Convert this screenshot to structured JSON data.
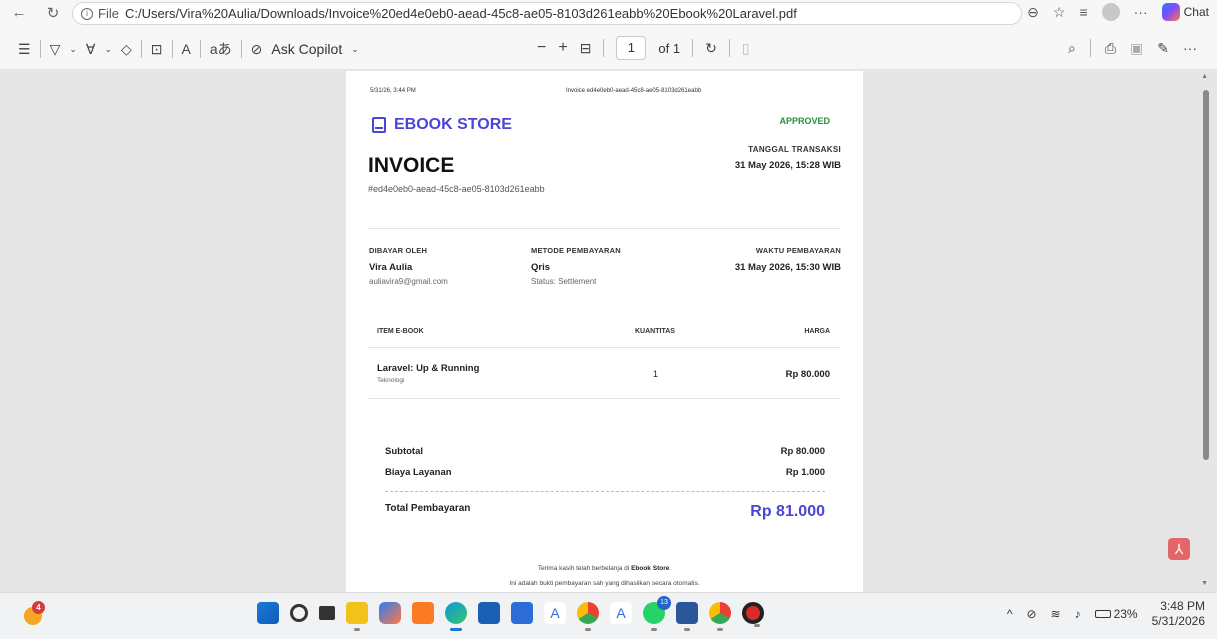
{
  "browser": {
    "url_prefix": "File",
    "url": "C:/Users/Vira%20Aulia/Downloads/Invoice%20ed4e0eb0-aead-45c8-ae05-8103d261eabb%20Ebook%20Laravel.pdf",
    "chat_label": "Chat"
  },
  "pdf_toolbar": {
    "ask_copilot": "Ask Copilot",
    "page_current": "1",
    "page_total": "of 1"
  },
  "invoice": {
    "header_datetime": "5/31/26, 3:44 PM",
    "header_title": "Invoice ed4e0eb0-aead-45c8-ae05-8103d261eabb",
    "brand": "EBOOK STORE",
    "status": "APPROVED",
    "title": "INVOICE",
    "transaction_label": "TANGGAL TRANSAKSI",
    "transaction_date": "31 May 2026, 15:28 WIB",
    "invoice_id": "#ed4e0eb0-aead-45c8-ae05-8103d261eabb",
    "paid_by_label": "DIBAYAR OLEH",
    "paid_by_name": "Vira Aulia",
    "paid_by_email": "auliavira9@gmail.com",
    "method_label": "METODE PEMBAYARAN",
    "method_value": "Qris",
    "method_status": "Status: Settlement",
    "payment_time_label": "WAKTU PEMBAYARAN",
    "payment_time_value": "31 May 2026, 15:30 WIB",
    "table_headers": {
      "item": "ITEM E-BOOK",
      "qty": "KUANTITAS",
      "price": "HARGA"
    },
    "items": [
      {
        "name": "Laravel: Up & Running",
        "category": "Teknologi",
        "qty": "1",
        "price": "Rp 80.000"
      }
    ],
    "subtotal_label": "Subtotal",
    "subtotal_value": "Rp 80.000",
    "fee_label": "Biaya Layanan",
    "fee_value": "Rp 1.000",
    "total_label": "Total Pembayaran",
    "total_value": "Rp 81.000",
    "thanks_prefix": "Terima kasih telah berbelanja di",
    "thanks_store": "Ebook Store",
    "thanks_suffix": ".",
    "footer_note": "Ini adalah bukti pembayaran sah yang dihasilkan secara otomatis."
  },
  "taskbar": {
    "weather_badge": "4",
    "whatsapp_badge": "13",
    "battery": "23%",
    "time": "3:48 PM",
    "date": "5/31/2026"
  },
  "colors": {
    "accent": "#4b45d6",
    "approved": "#2a8f3a"
  }
}
